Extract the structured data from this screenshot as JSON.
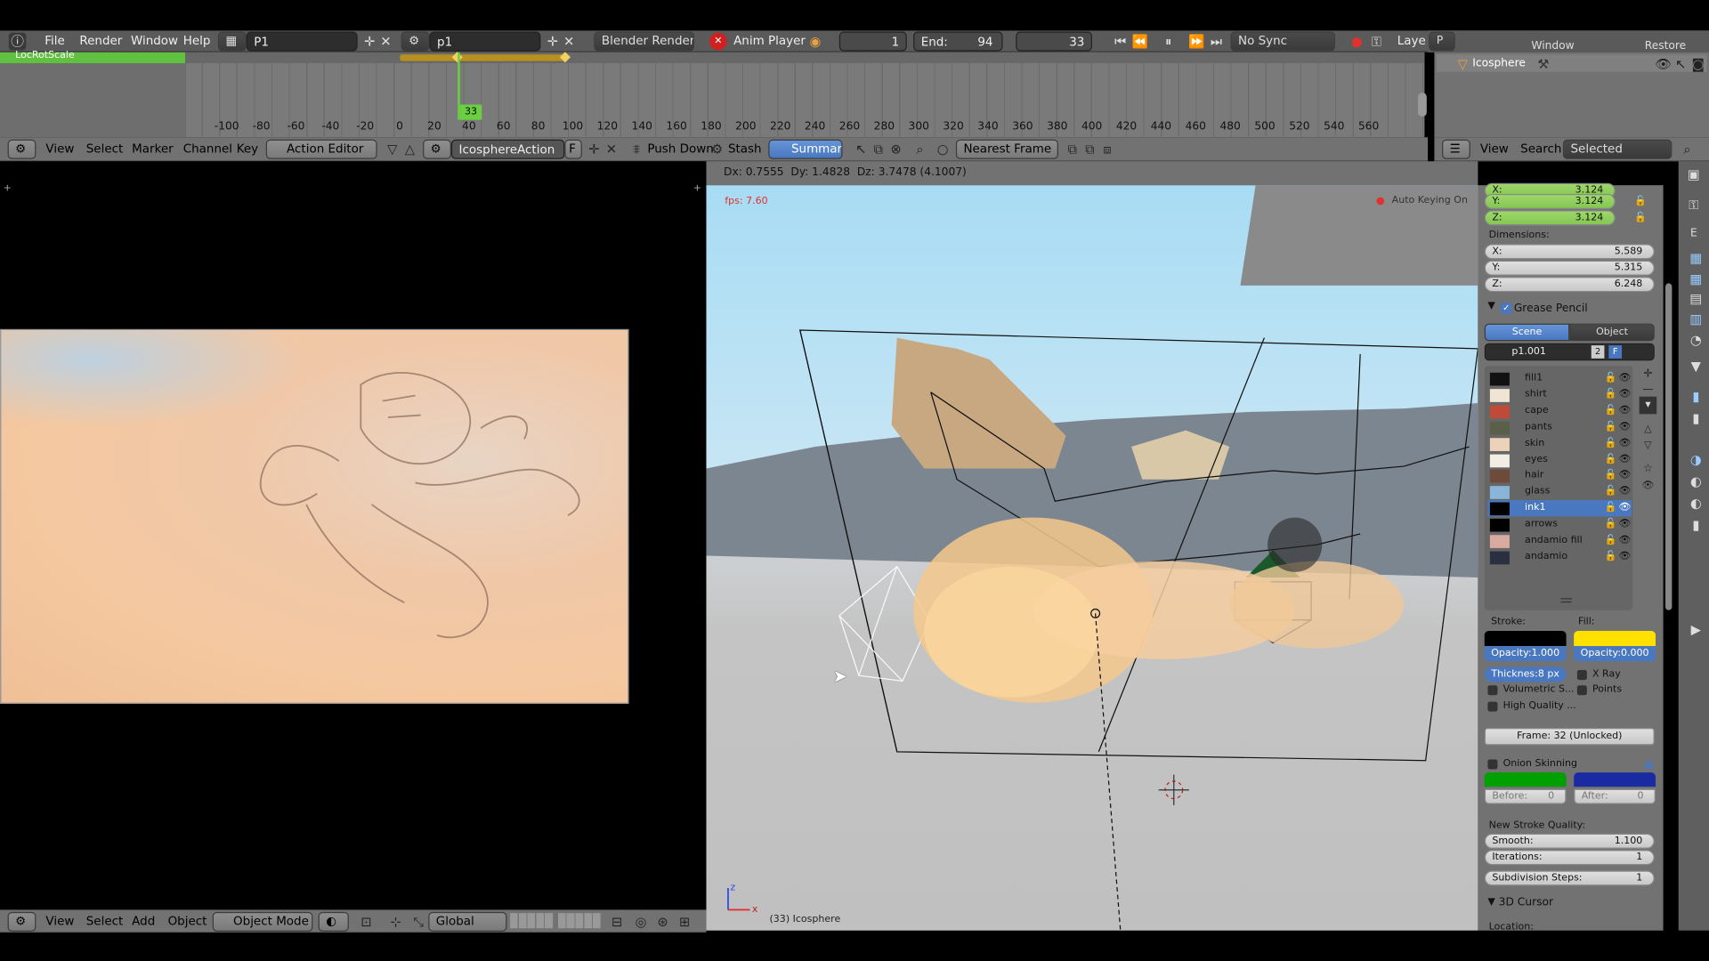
{
  "top_menu": {
    "items": [
      "File",
      "Render",
      "Window",
      "Help"
    ],
    "screen_name": "P1",
    "scene_name": "p1",
    "render_engine": "Blender Render",
    "anim_player": "Anim Player",
    "frame_current": "1",
    "end_label": "End:",
    "end_value": "94",
    "frame_field": "33",
    "sync": "No Sync",
    "layer_label": "Laye",
    "p_label": "P",
    "restore": "Restore",
    "window_label": "Window"
  },
  "timeline": {
    "channel": "LocRotScale",
    "current_frame": "33",
    "ticks": [
      "-100",
      "-80",
      "-60",
      "-40",
      "-20",
      "0",
      "20",
      "40",
      "60",
      "80",
      "100",
      "120",
      "140",
      "160",
      "180",
      "200",
      "220",
      "240",
      "260",
      "280",
      "300",
      "320",
      "340",
      "360",
      "380",
      "400",
      "420",
      "440",
      "460",
      "480",
      "500",
      "520",
      "540",
      "560"
    ]
  },
  "action_editor_header": {
    "menus": [
      "View",
      "Select",
      "Marker",
      "Channel",
      "Key"
    ],
    "mode": "Action Editor",
    "action_name": "IcosphereAction",
    "f_label": "F",
    "push_down": "Push Down",
    "stash": "Stash",
    "summary": "Summary",
    "nearest_frame": "Nearest Frame"
  },
  "outliner": {
    "object": "Icosphere",
    "menus": [
      "View",
      "Search"
    ],
    "filter": "Selected"
  },
  "viewport": {
    "status": "Dx: 0.7555  Dy: 1.4828  Dz: 3.7478 (4.1007)",
    "fps": "fps: 7.60",
    "auto_keying": "Auto Keying On",
    "object_info": "(33) Icosphere"
  },
  "bottom_header": {
    "menus": [
      "View",
      "Select",
      "Add",
      "Object"
    ],
    "mode": "Object Mode",
    "orientation": "Global"
  },
  "properties": {
    "scale_x_label": "X:",
    "scale_x": "3.124",
    "scale_y_label": "Y:",
    "scale_y": "3.124",
    "scale_z_label": "Z:",
    "scale_z": "3.124",
    "dimensions_label": "Dimensions:",
    "dim_x_label": "X:",
    "dim_x": "5.589",
    "dim_y_label": "Y:",
    "dim_y": "5.315",
    "dim_z_label": "Z:",
    "dim_z": "6.248",
    "grease_pencil": "Grease Pencil",
    "tab_scene": "Scene",
    "tab_object": "Object",
    "gp_name": "p1.001",
    "gp_users": "2",
    "gp_f": "F",
    "layers": [
      {
        "name": "fill1",
        "color": "#111111"
      },
      {
        "name": "shirt",
        "color": "#f0e4d4"
      },
      {
        "name": "cape",
        "color": "#c04a38"
      },
      {
        "name": "pants",
        "color": "#5a6048"
      },
      {
        "name": "skin",
        "color": "#ecd2b8"
      },
      {
        "name": "eyes",
        "color": "#f2eee4"
      },
      {
        "name": "hair",
        "color": "#6e4a3a"
      },
      {
        "name": "glass",
        "color": "#8ab4d8"
      },
      {
        "name": "ink1",
        "color": "#000000"
      },
      {
        "name": "arrows",
        "color": "#000000"
      },
      {
        "name": "andamio fill",
        "color": "#d8aaa0"
      },
      {
        "name": "andamio",
        "color": "#2a3040"
      }
    ],
    "stroke_label": "Stroke:",
    "fill_label": "Fill:",
    "stroke_opacity": "Opacity:1.000",
    "fill_opacity": "Opacity:0.000",
    "thickness": "Thicknes:8 px",
    "x_ray": "X Ray",
    "volumetric": "Volumetric S...",
    "points": "Points",
    "high_quality": "High Quality ...",
    "frame_info": "Frame: 32 (Unlocked)",
    "onion_skinning": "Onion Skinning",
    "before_label": "Before:",
    "before": "0",
    "after_label": "After:",
    "after": "0",
    "new_stroke_quality": "New Stroke Quality:",
    "smooth_label": "Smooth:",
    "smooth": "1.100",
    "iterations_label": "Iterations:",
    "iterations": "1",
    "subdiv_label": "Subdivision Steps:",
    "subdiv": "1",
    "cursor_3d": "3D Cursor",
    "location": "Location:",
    "stroke_color": "#000000",
    "fill_color": "#ffe100"
  }
}
